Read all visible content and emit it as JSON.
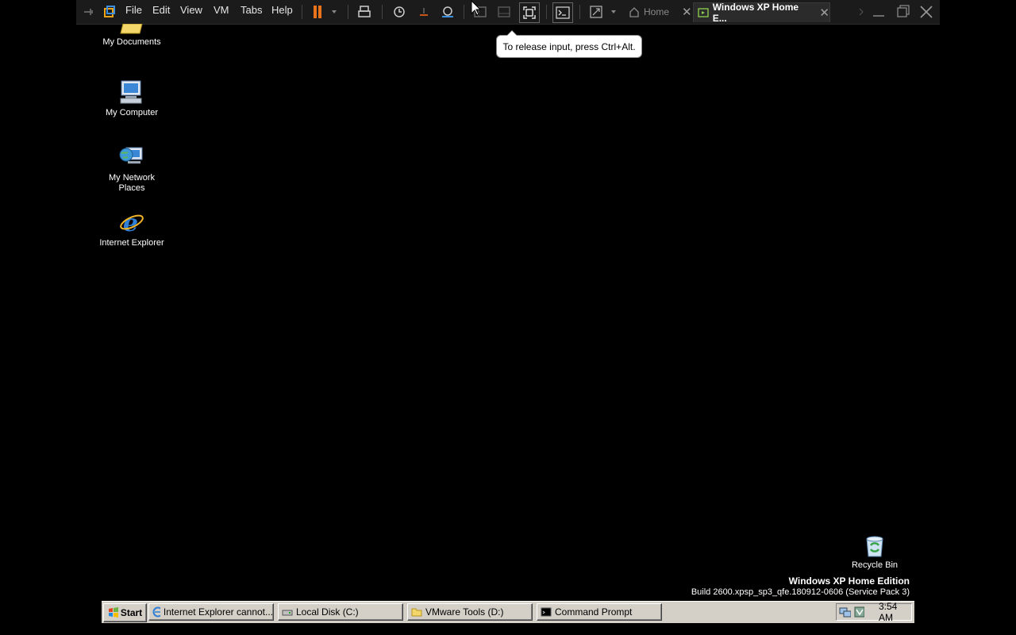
{
  "toolbar": {
    "menus": [
      "File",
      "Edit",
      "View",
      "VM",
      "Tabs",
      "Help"
    ],
    "tabs": [
      {
        "label": "Home",
        "icon": "home-icon",
        "active": false
      },
      {
        "label": "Windows XP Home E...",
        "icon": "vm-tab-icon",
        "active": true
      }
    ],
    "pause_color": "#e8731a"
  },
  "tooltip": {
    "text": "To release input, press Ctrl+Alt."
  },
  "desktop": {
    "icons": [
      {
        "label": "My Documents",
        "icon": "folder-documents-icon"
      },
      {
        "label": "My Computer",
        "icon": "computer-icon"
      },
      {
        "label": "My Network Places",
        "icon": "network-places-icon"
      },
      {
        "label": "Internet Explorer",
        "icon": "internet-explorer-icon"
      },
      {
        "label": "Recycle Bin",
        "icon": "recycle-bin-icon"
      }
    ],
    "edition": "Windows XP Home Edition",
    "build": "Build 2600.xpsp_sp3_qfe.180912-0606 (Service Pack 3)"
  },
  "taskbar": {
    "start": "Start",
    "buttons": [
      {
        "label": "Internet Explorer cannot...",
        "icon": "ie-icon"
      },
      {
        "label": "Local Disk (C:)",
        "icon": "drive-icon"
      },
      {
        "label": "VMware Tools (D:)",
        "icon": "folder-icon"
      },
      {
        "label": "Command Prompt",
        "icon": "cmd-icon"
      }
    ],
    "clock": "3:54 AM"
  }
}
